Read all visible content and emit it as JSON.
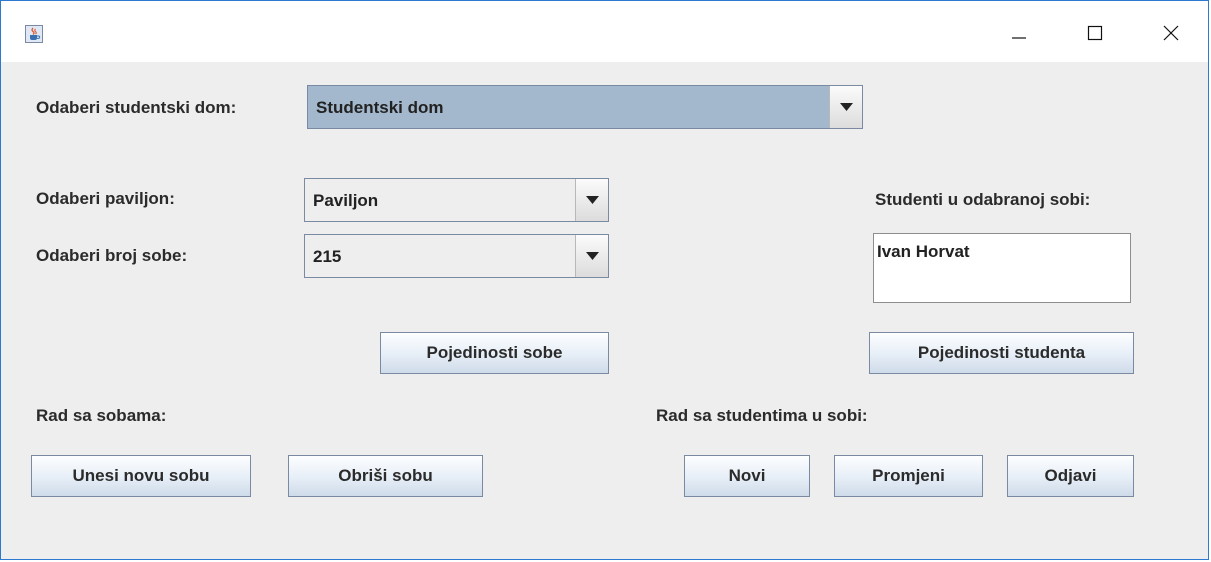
{
  "window": {
    "title": "",
    "icon": "java-cup-icon",
    "controls": [
      "minimize-icon",
      "maximize-icon",
      "close-icon"
    ]
  },
  "dorm": {
    "label": "Odaberi studentski dom:",
    "selected": "Studentski dom"
  },
  "pavilion": {
    "label": "Odaberi paviljon:",
    "selected": "Paviljon"
  },
  "room": {
    "label": "Odaberi broj sobe:",
    "selected": "215"
  },
  "students": {
    "label": "Studenti u odabranoj sobi:",
    "items": [
      "Ivan Horvat"
    ]
  },
  "buttons": {
    "room_details": "Pojedinosti sobe",
    "student_details": "Pojedinosti studenta",
    "new_room": "Unesi novu sobu",
    "delete_room": "Obriši sobu",
    "new_student": "Novi",
    "change_student": "Promjeni",
    "checkout_student": "Odjavi"
  },
  "sections": {
    "rooms": "Rad sa sobama:",
    "students": "Rad sa studentima u sobi:"
  },
  "colors": {
    "window_border": "#2b79d0",
    "focused_combo": "#a3b8cc",
    "background": "#eeeeee"
  }
}
